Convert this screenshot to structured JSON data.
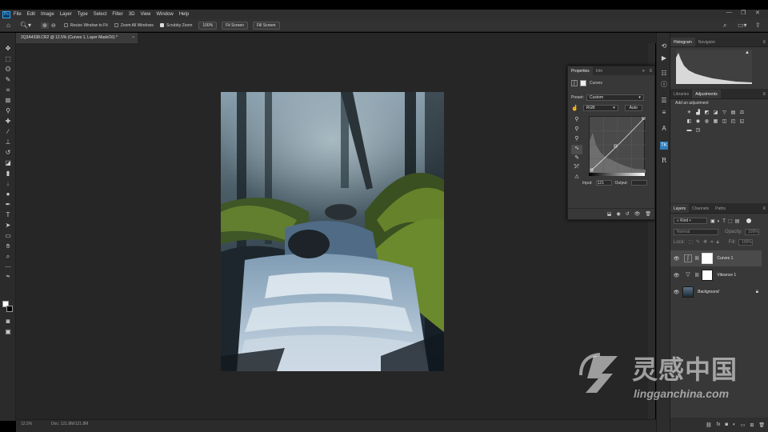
{
  "app": {
    "logo_text": "Ps",
    "menu": [
      "File",
      "Edit",
      "Image",
      "Layer",
      "Type",
      "Select",
      "Filter",
      "3D",
      "View",
      "Window",
      "Help"
    ],
    "window_controls": [
      "—",
      "❐",
      "✕"
    ]
  },
  "options_bar": {
    "resize_windows_label": "Resize Window to Fit",
    "resize_windows_checked": false,
    "zoom_all_label": "Zoom All Windows",
    "zoom_all_checked": false,
    "scrubby_label": "Scrubby Zoom",
    "scrubby_checked": true,
    "zoom_100_label": "100%",
    "fit_screen_label": "Fit Screen",
    "fill_screen_label": "Fill Screen"
  },
  "document": {
    "tab_title": "2Q3A4338.CR2 @ 12.5% (Curves 1, Layer Mask/16) *",
    "close_label": "×"
  },
  "status": {
    "zoom": "12.5%",
    "doc_info": "Doc: 121.8M/121.8M"
  },
  "properties_panel": {
    "tabs": [
      "Properties",
      "Info"
    ],
    "layer_type": "Curves",
    "preset_label": "Preset:",
    "preset_value": "Custom",
    "channel_value": "RGB",
    "auto_label": "Auto",
    "input_label": "Input:",
    "input_value": "121",
    "output_label": "Output:",
    "output_value": ""
  },
  "histogram_panel": {
    "tabs": [
      "Histogram",
      "Navigator"
    ]
  },
  "adjustments_panel": {
    "tabs": [
      "Libraries",
      "Adjustments"
    ],
    "add_label": "Add an adjustment"
  },
  "layers_panel": {
    "tabs": [
      "Layers",
      "Channels",
      "Paths"
    ],
    "kind_label": "Kind",
    "blend_mode": "Normal",
    "opacity_label": "Opacity:",
    "opacity_value": "100%",
    "lock_label": "Lock:",
    "fill_label": "Fill:",
    "fill_value": "100%",
    "layers": [
      {
        "name": "Curves 1",
        "selected": true
      },
      {
        "name": "Vibrance 1",
        "selected": false
      },
      {
        "name": "Background",
        "selected": false
      }
    ]
  },
  "watermark": {
    "cn": "灵感中国",
    "en": "lingganchina.com"
  },
  "colors": {
    "accent": "#31a8ff",
    "panel_bg": "#383838",
    "canvas_bg": "#262626"
  }
}
